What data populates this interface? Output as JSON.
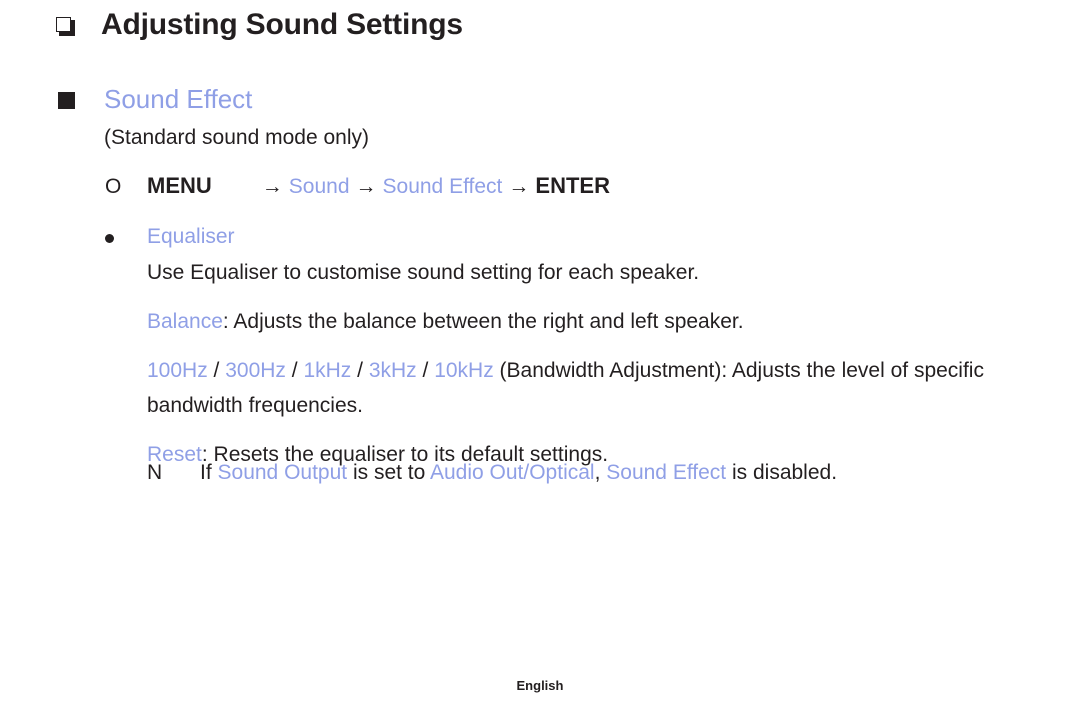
{
  "colors": {
    "accent": "#8f9fe6",
    "text": "#231f20",
    "background": "#ffffff"
  },
  "chapter": {
    "marker_icon": "hollow-square-icon",
    "title": "Adjusting Sound Settings"
  },
  "section": {
    "marker_icon": "filled-square-icon",
    "title": "Sound Effect",
    "condition": "(Standard sound mode only)"
  },
  "menu_path": {
    "marker_icon": "circle-outline-icon",
    "marker_glyph": "O",
    "key_label": "MENU",
    "arrow": "→",
    "item1": "Sound",
    "item2": "Sound Effect",
    "enter_label": "ENTER"
  },
  "equaliser": {
    "marker_icon": "bullet-dot-icon",
    "label": "Equaliser",
    "description": "Use Equaliser to customise sound setting for each speaker.",
    "balance": {
      "term": "Balance",
      "text": ": Adjusts the balance between the right and left speaker."
    },
    "bandwidth": {
      "freq1": "100Hz",
      "sep1": " / ",
      "freq2": "300Hz",
      "sep2": " / ",
      "freq3": "1kHz",
      "sep3": " / ",
      "freq4": "3kHz",
      "sep4": " / ",
      "freq5": "10kHz",
      "text": " (Bandwidth Adjustment): Adjusts the level of specific bandwidth frequencies."
    },
    "reset": {
      "term": "Reset",
      "text": ": Resets the equaliser to its default settings."
    }
  },
  "note": {
    "marker_icon": "note-n-icon",
    "marker_glyph": "N",
    "prefix": "If ",
    "term1": "Sound Output",
    "middle": " is set to ",
    "term2": "Audio Out/Optical",
    "comma": ", ",
    "term3": "Sound Effect",
    "suffix": " is disabled."
  },
  "footer": {
    "language": "English"
  }
}
